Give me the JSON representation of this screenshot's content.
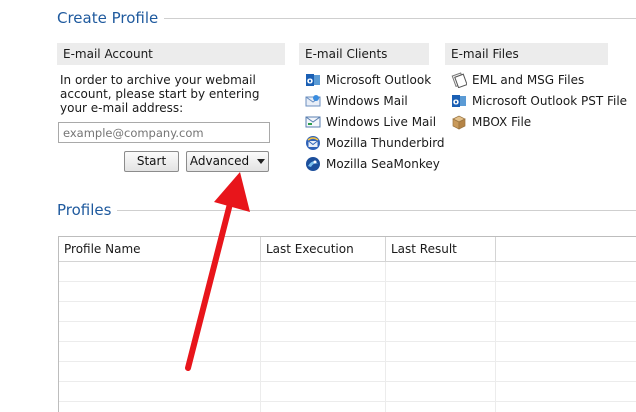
{
  "create_profile": {
    "title": "Create Profile",
    "email_account": {
      "header": "E-mail Account",
      "description": "In order to archive your webmail account, please start by entering your e-mail address:",
      "email_placeholder": "example@company.com",
      "start_label": "Start",
      "advanced_label": "Advanced"
    },
    "email_clients": {
      "header": "E-mail Clients",
      "items": [
        {
          "label": "Microsoft Outlook",
          "icon": "outlook-icon"
        },
        {
          "label": "Windows Mail",
          "icon": "windows-mail-icon"
        },
        {
          "label": "Windows Live Mail",
          "icon": "windows-live-mail-icon"
        },
        {
          "label": "Mozilla Thunderbird",
          "icon": "thunderbird-icon"
        },
        {
          "label": "Mozilla SeaMonkey",
          "icon": "seamonkey-icon"
        }
      ]
    },
    "email_files": {
      "header": "E-mail Files",
      "items": [
        {
          "label": "EML and MSG Files",
          "icon": "eml-msg-files-icon"
        },
        {
          "label": "Microsoft Outlook PST File",
          "icon": "outlook-pst-icon"
        },
        {
          "label": "MBOX File",
          "icon": "mbox-file-icon"
        }
      ]
    }
  },
  "profiles": {
    "title": "Profiles",
    "columns": [
      "Profile Name",
      "Last Execution",
      "Last Result"
    ]
  },
  "colors": {
    "section_title": "#1f5a9e",
    "annotation_arrow": "#e8151b"
  }
}
